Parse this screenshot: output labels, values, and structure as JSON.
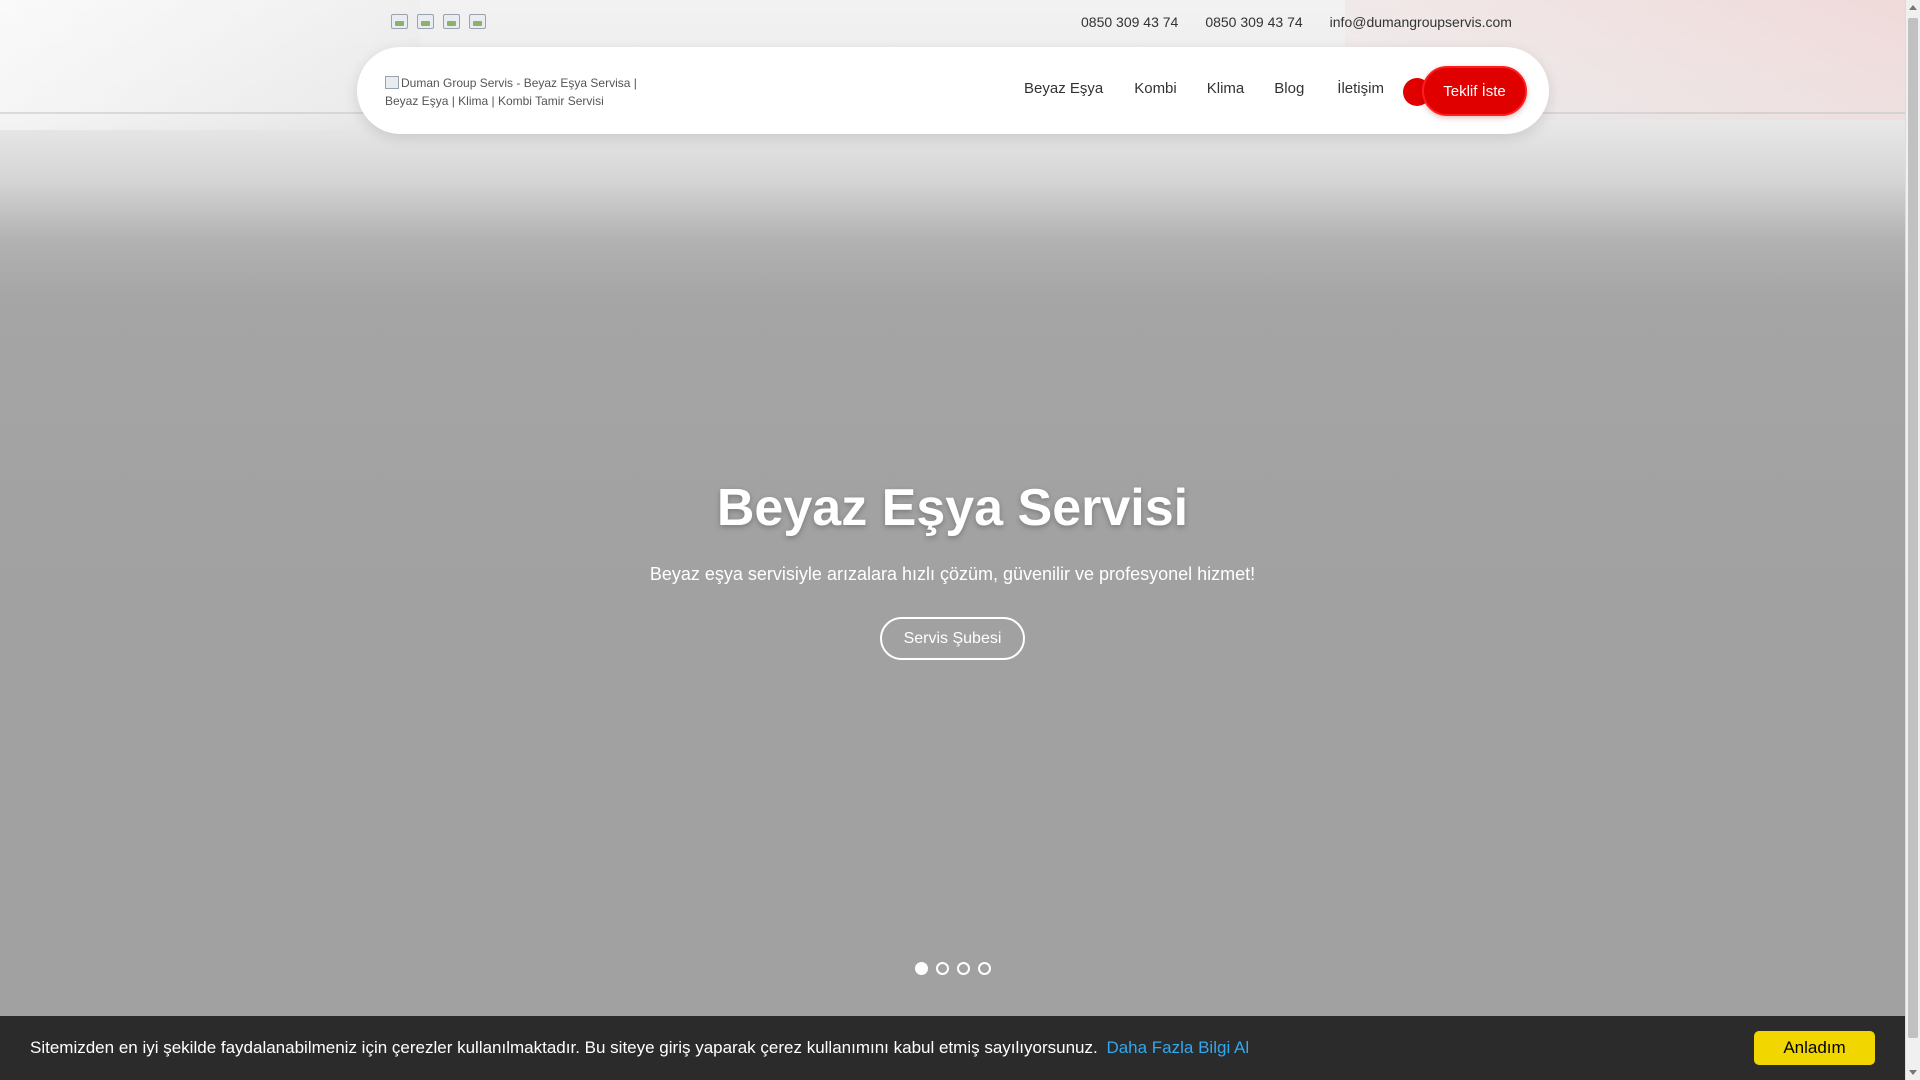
{
  "topbar": {
    "social_icons": [
      "facebook-icon",
      "twitter-icon",
      "instagram-icon",
      "youtube-icon"
    ],
    "phone_1": "0850 309 43 74",
    "phone_2": "0850 309 43 74",
    "email": "info@dumangroupservis.com"
  },
  "header": {
    "logo_alt": "Duman Group Servis - Beyaz Eşya Servisa | Beyaz Eşya | Klima | Kombi Tamir Servisi",
    "nav": [
      "Beyaz Eşya",
      "Kombi",
      "Klima",
      "Blog",
      "İletişim"
    ],
    "cta_label": "Teklif İste",
    "accent_color": "#e00000"
  },
  "hero": {
    "title": "Beyaz Eşya Servisi",
    "subtitle": "Beyaz eşya servisiyle arızalara hızlı çözüm, güvenilir ve profesyonel hizmet!",
    "button_label": "Servis Şubesi",
    "slide_count": 4,
    "active_slide": 1
  },
  "cookie": {
    "text": "Sitemizden en iyi şekilde faydalanabilmeniz için çerezler kullanılmaktadır. Bu siteye giriş yaparak çerez kullanımını kabul etmiş sayılıyorsunuz.",
    "link_text": "Daha Fazla Bilgi Al",
    "button_label": "Anladım",
    "button_color": "#f1d600",
    "link_color": "#31a8f0"
  }
}
